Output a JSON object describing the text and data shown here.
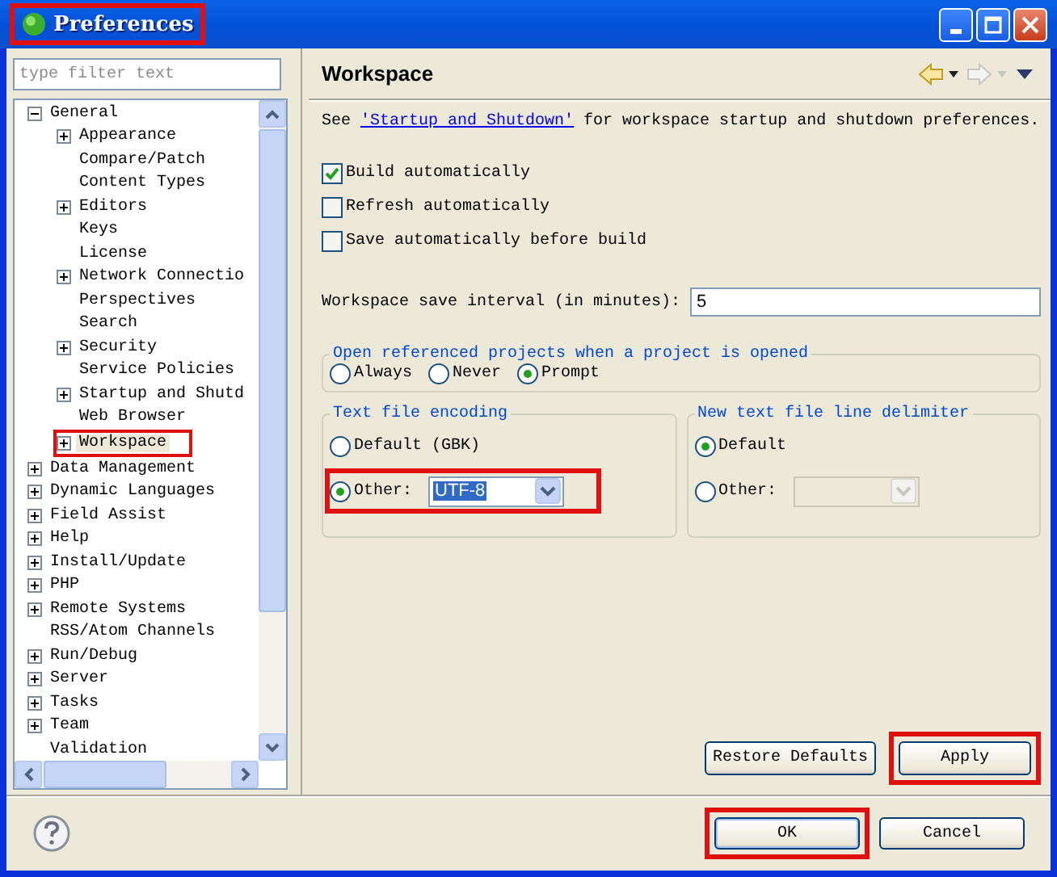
{
  "window": {
    "title": "Preferences",
    "highlighted": true
  },
  "filter": {
    "placeholder": "type filter text"
  },
  "tree": [
    {
      "label": "General",
      "expanded": true,
      "selected": false,
      "highlighted": false,
      "children": [
        {
          "label": "Appearance",
          "expanded": false,
          "selected": false,
          "highlighted": false
        },
        {
          "label": "Compare/Patch",
          "selected": false,
          "highlighted": false
        },
        {
          "label": "Content Types",
          "selected": false,
          "highlighted": false
        },
        {
          "label": "Editors",
          "expanded": false,
          "selected": false,
          "highlighted": false
        },
        {
          "label": "Keys",
          "selected": false,
          "highlighted": false
        },
        {
          "label": "License",
          "selected": false,
          "highlighted": false
        },
        {
          "label": "Network Connectio",
          "expanded": false,
          "selected": false,
          "highlighted": false
        },
        {
          "label": "Perspectives",
          "selected": false,
          "highlighted": false
        },
        {
          "label": "Search",
          "selected": false,
          "highlighted": false
        },
        {
          "label": "Security",
          "expanded": false,
          "selected": false,
          "highlighted": false
        },
        {
          "label": "Service Policies",
          "selected": false,
          "highlighted": false
        },
        {
          "label": "Startup and Shutd",
          "expanded": false,
          "selected": false,
          "highlighted": false
        },
        {
          "label": "Web Browser",
          "selected": false,
          "highlighted": false
        },
        {
          "label": "Workspace",
          "expanded": false,
          "selected": true,
          "highlighted": true
        }
      ]
    },
    {
      "label": "Data Management",
      "expanded": false,
      "selected": false,
      "highlighted": false
    },
    {
      "label": "Dynamic Languages",
      "expanded": false,
      "selected": false,
      "highlighted": false
    },
    {
      "label": "Field Assist",
      "expanded": false,
      "selected": false,
      "highlighted": false
    },
    {
      "label": "Help",
      "expanded": false,
      "selected": false,
      "highlighted": false
    },
    {
      "label": "Install/Update",
      "expanded": false,
      "selected": false,
      "highlighted": false
    },
    {
      "label": "PHP",
      "expanded": false,
      "selected": false,
      "highlighted": false
    },
    {
      "label": "Remote Systems",
      "expanded": false,
      "selected": false,
      "highlighted": false
    },
    {
      "label": "RSS/Atom Channels",
      "selected": false,
      "highlighted": false
    },
    {
      "label": "Run/Debug",
      "expanded": false,
      "selected": false,
      "highlighted": false
    },
    {
      "label": "Server",
      "expanded": false,
      "selected": false,
      "highlighted": false
    },
    {
      "label": "Tasks",
      "expanded": false,
      "selected": false,
      "highlighted": false
    },
    {
      "label": "Team",
      "expanded": false,
      "selected": false,
      "highlighted": false
    },
    {
      "label": "Validation",
      "selected": false,
      "highlighted": false
    }
  ],
  "page": {
    "title": "Workspace",
    "intro": {
      "before": "See ",
      "link": "'Startup and Shutdown'",
      "after": " for workspace startup and shutdown preferences."
    },
    "checkboxes": [
      {
        "label": "Build automatically",
        "checked": true
      },
      {
        "label": "Refresh automatically",
        "checked": false
      },
      {
        "label": "Save automatically before build",
        "checked": false
      }
    ],
    "interval": {
      "label": "Workspace save interval (in minutes):",
      "value": "5"
    },
    "open_referenced": {
      "title": "Open referenced projects when a project is opened",
      "options": [
        {
          "label": "Always",
          "selected": false
        },
        {
          "label": "Never",
          "selected": false
        },
        {
          "label": "Prompt",
          "selected": true
        }
      ]
    },
    "encoding": {
      "title": "Text file encoding",
      "options": [
        {
          "label": "Default (GBK)",
          "selected": false,
          "highlighted": false
        },
        {
          "label": "Other:",
          "selected": true,
          "highlighted": true,
          "dropdown": {
            "value": "UTF-8",
            "disabled": false
          }
        }
      ]
    },
    "delimiter": {
      "title": "New text file line delimiter",
      "options": [
        {
          "label": "Default",
          "selected": true,
          "highlighted": false
        },
        {
          "label": "Other:",
          "selected": false,
          "highlighted": false,
          "dropdown": {
            "disabled": true
          }
        }
      ]
    },
    "buttons": [
      {
        "label": "Restore Defaults",
        "highlighted": false
      },
      {
        "label": "Apply",
        "highlighted": true
      }
    ]
  },
  "footer": {
    "buttons": [
      {
        "label": "OK",
        "highlighted": true
      },
      {
        "label": "Cancel",
        "highlighted": false
      }
    ]
  }
}
